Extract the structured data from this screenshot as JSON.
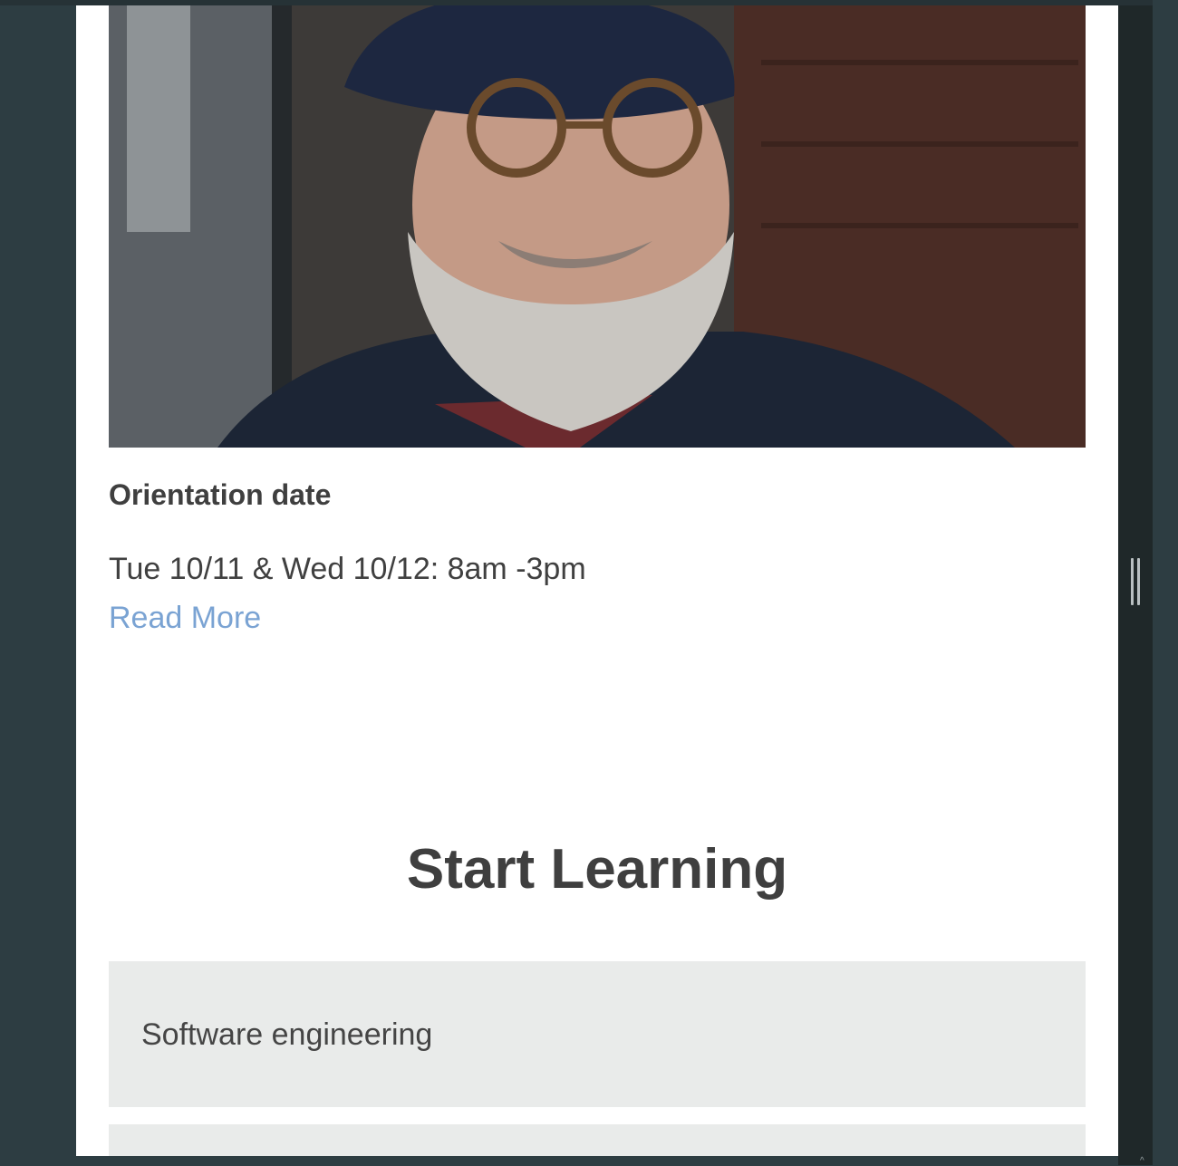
{
  "article": {
    "image_alt": "Portrait of an older man with a beard, glasses and a beret",
    "heading": "Orientation date",
    "dates": "Tue 10/11 & Wed 10/12: 8am -3pm",
    "read_more": "Read More"
  },
  "learning": {
    "title": "Start Learning",
    "courses": [
      {
        "label": "Software engineering"
      },
      {
        "label": ""
      }
    ]
  },
  "colors": {
    "link": "#7aa3d3",
    "text": "#3f3f3f",
    "card_background": "#e9ebea",
    "backdrop": "#2d3d42"
  }
}
